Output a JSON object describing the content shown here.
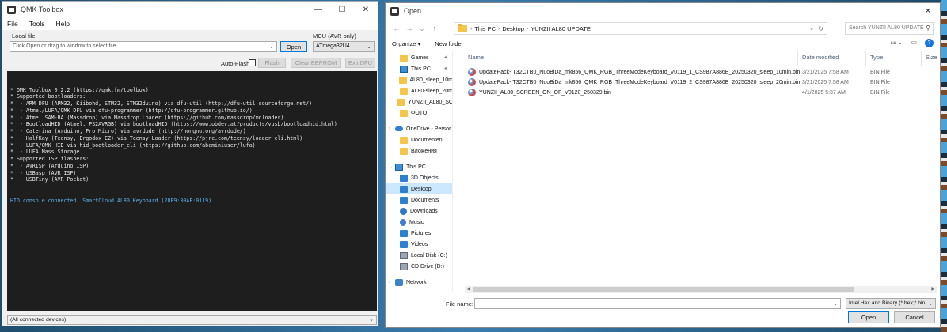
{
  "qmk": {
    "title": "QMK Toolbox",
    "menu": [
      "File",
      "Tools",
      "Help"
    ],
    "local_file_label": "Local file",
    "file_placeholder": "Click Open or drag to window to select file",
    "open_button": "Open",
    "mcu_label": "MCU (AVR only)",
    "mcu_value": "ATmega32U4",
    "auto_flash_label": "Auto-Flash",
    "flash_button": "Flash",
    "clear_eeprom_button": "Clear EEPROM",
    "exit_dfu_button": "Exit DFU",
    "console_lines": [
      "* QMK Toolbox 0.2.2 (https://qmk.fm/toolbox)",
      "* Supported bootloaders:",
      "*  - ARM DFU (APM32, Kiibohd, STM32, STM32duino) via dfu-util (http://dfu-util.sourceforge.net/)",
      "*  - Atmel/LUFA/QMK DFU via dfu-programmer (http://dfu-programmer.github.io/)",
      "*  - Atmel SAM-BA (Massdrop) via Massdrop Loader (https://github.com/massdrop/mdloader)",
      "*  - BootloadHID (Atmel, PS2AVRGB) via bootloadHID (https://www.obdev.at/products/vusb/bootloadhid.html)",
      "*  - Caterina (Arduino, Pro Micro) via avrdude (http://nongnu.org/avrdude/)",
      "*  - HalfKay (Teensy, Ergodox EZ) via Teensy Loader (https://pjrc.com/teensy/loader_cli.html)",
      "*  - LUFA/QMK HID via hid_bootloader_cli (https://github.com/abcminiuser/lufa)",
      "*  - LUFA Mass Storage",
      "* Supported ISP flashers:",
      "*  - AVRISP (Arduino ISP)",
      "*  - USBasp (AVR ISP)",
      "*  - USBTiny (AVR Pocket)"
    ],
    "console_hid_line": "HID console connected: SmartCloud AL80 Keyboard (28E9:30AF:0119)",
    "devices_select": "(All connected devices)"
  },
  "dialog": {
    "title": "Open",
    "breadcrumb": [
      "This PC",
      "Desktop",
      "YUNZII AL80 UPDATE"
    ],
    "search_placeholder": "Search YUNZII AL80 UPDATE",
    "organize_label": "Organize ▾",
    "new_folder_label": "New folder",
    "nav_items": [
      {
        "label": "Games",
        "icon": "folder-icon"
      },
      {
        "label": "This PC",
        "icon": "pc-icon"
      },
      {
        "label": "AL80_sleep_10m",
        "icon": "folder-icon"
      },
      {
        "label": "AL80-sleep_20m",
        "icon": "folder-icon"
      },
      {
        "label": "YUNZII_AL80_SC",
        "icon": "folder-icon"
      },
      {
        "label": "ФОТО",
        "icon": "folder-icon"
      },
      {
        "label": "OneDrive - Persor",
        "icon": "cloud-icon"
      },
      {
        "label": "Documenten",
        "icon": "folder-icon"
      },
      {
        "label": "Вложения",
        "icon": "folder-icon"
      },
      {
        "label": "This PC",
        "icon": "pc-icon"
      },
      {
        "label": "3D Objects",
        "icon": "3d-objects-icon"
      },
      {
        "label": "Desktop",
        "icon": "desktop-icon"
      },
      {
        "label": "Documents",
        "icon": "documents-icon"
      },
      {
        "label": "Downloads",
        "icon": "download-icon"
      },
      {
        "label": "Music",
        "icon": "music-icon"
      },
      {
        "label": "Pictures",
        "icon": "pictures-icon"
      },
      {
        "label": "Videos",
        "icon": "videos-icon"
      },
      {
        "label": "Local Disk (C:)",
        "icon": "disk-icon"
      },
      {
        "label": "CD Drive (D:)",
        "icon": "cd-drive-icon"
      },
      {
        "label": "Network",
        "icon": "network-icon"
      }
    ],
    "columns": {
      "name": "Name",
      "date": "Date modified",
      "type": "Type",
      "size": "Size"
    },
    "files": [
      {
        "name": "UpdatePack-IT32CTB0_NuoBiDa_mk856_QMK_RGB_ThreeModeKeyboard_V0119_1_CS987A886B_20250320_sleep_10min.bin",
        "date": "3/21/2025 7:58 AM",
        "type": "BIN File"
      },
      {
        "name": "UpdatePack-IT32CTB0_NuoBiDa_mk856_QMK_RGB_ThreeModeKeyboard_V0119_2_CS987A886B_20250320_sleep_20min.bin",
        "date": "3/21/2025 7:58 AM",
        "type": "BIN File"
      },
      {
        "name": "YUNZII_AL80_SCREEN_ON_OF_V0120_250329.bin",
        "date": "4/1/2025 5:37 AM",
        "type": "BIN File"
      }
    ],
    "file_name_label": "File name:",
    "file_name_value": "",
    "filter_value": "Intel Hex and Binary (*.hex;*.bin",
    "open_button": "Open",
    "cancel_button": "Cancel"
  },
  "colors": {
    "accent": "#0078d7",
    "console_bg": "#1e1e1e",
    "console_hid": "#5fb0e8",
    "nav_selected": "#cce8ff"
  }
}
